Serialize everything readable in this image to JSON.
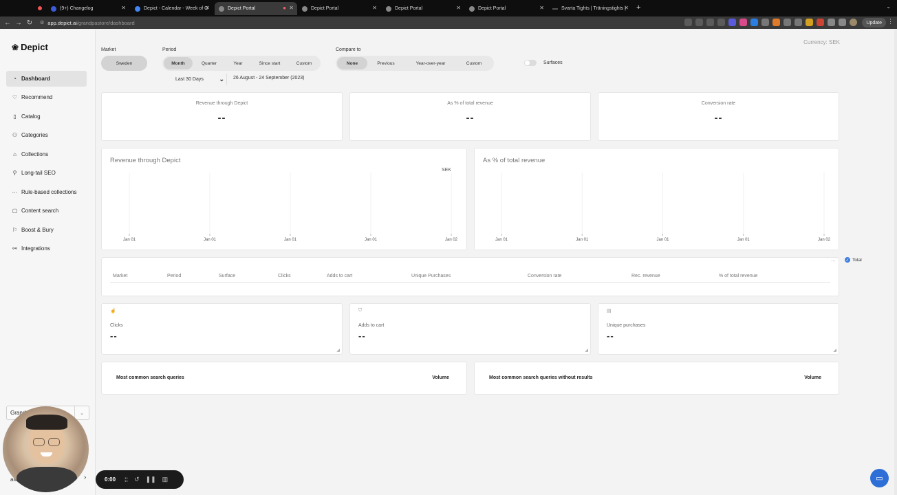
{
  "browser": {
    "tabs": [
      {
        "label": "(9+) Changelog",
        "color": "#3b5bdb"
      },
      {
        "label": "Depict - Calendar - Week of O",
        "color": "#4285f4"
      },
      {
        "label": "Depict Portal",
        "color": "#888888",
        "active": true
      },
      {
        "label": "Depict Portal",
        "color": "#888888"
      },
      {
        "label": "Depict Portal",
        "color": "#888888"
      },
      {
        "label": "Depict Portal",
        "color": "#888888"
      },
      {
        "label": "Svarta Tights | Träningstights |",
        "color": "#555555"
      }
    ],
    "url_host": "app.depict.ai",
    "url_path": "/grandpastore/dashboard",
    "update_label": "Update"
  },
  "sidebar": {
    "logo": "Depict",
    "items": [
      {
        "label": "Dashboard",
        "icon": "dashboard-icon",
        "active": true
      },
      {
        "label": "Recommend",
        "icon": "heart-icon"
      },
      {
        "label": "Catalog",
        "icon": "catalog-icon"
      },
      {
        "label": "Categories",
        "icon": "categories-icon"
      },
      {
        "label": "Collections",
        "icon": "collections-icon"
      },
      {
        "label": "Long-tail SEO",
        "icon": "search-icon"
      },
      {
        "label": "Rule-based collections",
        "icon": "rules-icon"
      },
      {
        "label": "Content search",
        "icon": "content-search-icon"
      },
      {
        "label": "Boost & Bury",
        "icon": "boost-icon"
      },
      {
        "label": "Integrations",
        "icon": "link-icon"
      }
    ],
    "store_value": "Grand",
    "user_text": "ale"
  },
  "filters": {
    "market_label": "Market",
    "market_value": "Sweden",
    "period_label": "Period",
    "period_options": [
      "Month",
      "Quarter",
      "Year",
      "Since start",
      "Custom"
    ],
    "period_selected": "Month",
    "range_select": "Last 30 Days",
    "range_text": "26 August - 24 September (2023)",
    "compare_label": "Compare to",
    "compare_options": [
      "None",
      "Previous",
      "Year-over-year",
      "Custom"
    ],
    "compare_selected": "None",
    "surfaces_label": "Surfaces",
    "currency": "Currency: SEK"
  },
  "kpis": [
    {
      "title": "Revenue through Depict",
      "value": "--"
    },
    {
      "title": "As % of total revenue",
      "value": "--"
    },
    {
      "title": "Conversion rate",
      "value": "--"
    }
  ],
  "chart_data": [
    {
      "type": "line",
      "title": "Revenue through Depict",
      "unit": "SEK",
      "x": [
        "Jan 01",
        "Jan 01",
        "Jan 01",
        "Jan 01",
        "Jan 02"
      ],
      "series": []
    },
    {
      "type": "line",
      "title": "As % of total revenue",
      "x": [
        "Jan 01",
        "Jan 01",
        "Jan 01",
        "Jan 01",
        "Jan 02"
      ],
      "series": []
    }
  ],
  "table": {
    "columns": [
      "Market",
      "Period",
      "Surface",
      "Clicks",
      "Adds to cart",
      "Unique Purchases",
      "Conversion rate",
      "Rec. revenue",
      "% of total revenue"
    ],
    "total_label": "Total",
    "more": "..."
  },
  "metrics": [
    {
      "title": "Clicks",
      "value": "--"
    },
    {
      "title": "Adds to cart",
      "value": "--"
    },
    {
      "title": "Unique purchases",
      "value": "--"
    }
  ],
  "queries": [
    {
      "title": "Most common search queries",
      "volume": "Volume"
    },
    {
      "title": "Most common search queries without results",
      "volume": "Volume"
    }
  ],
  "recorder": {
    "time": "0:00"
  }
}
